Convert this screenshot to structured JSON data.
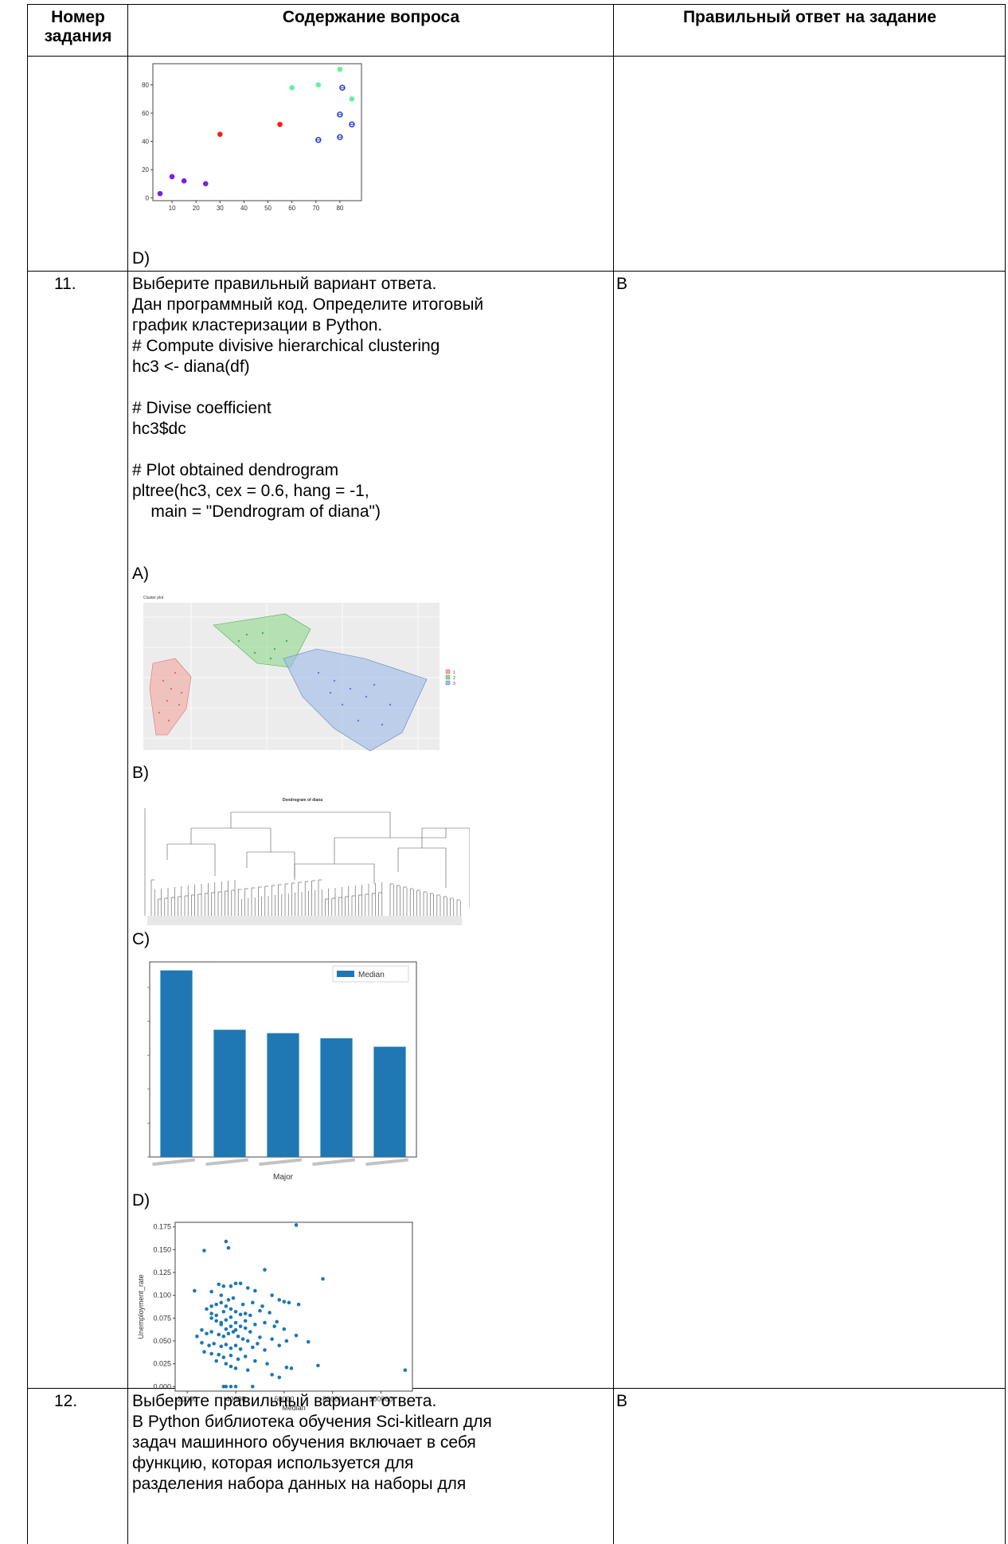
{
  "header": {
    "col1": [
      "Номер",
      "задания"
    ],
    "col2": "Содержание вопроса",
    "col3": "Правильный ответ на задание"
  },
  "row0": {
    "option_label": "D)"
  },
  "q11": {
    "number": "11.",
    "lines": [
      "Выберите правильный вариант ответа.",
      "Дан программный код. Определите итоговый",
      "график кластеризации в Python.",
      "# Compute divisive hierarchical clustering",
      "hc3 <- diana(df)",
      "",
      "# Divise coefficient",
      "hc3$dc",
      "",
      "# Plot obtained dendrogram",
      "pltree(hc3, cex = 0.6, hang = -1,",
      "    main = \"Dendrogram of diana\")"
    ],
    "answer": "B",
    "options": [
      "A)",
      "B)",
      "C)",
      "D)"
    ]
  },
  "q12": {
    "number": "12.",
    "lines": [
      "Выберите правильный вариант ответа.",
      "В Python библиотека обучения Sci-kitlearn для",
      "задач машинного обучения включает в себя",
      "функцию, которая используется для",
      "разделения набора данных на наборы для"
    ],
    "answer": "B"
  },
  "chart_data": [
    {
      "type": "scatter",
      "xlim": [
        2,
        89
      ],
      "ylim": [
        -2,
        95
      ],
      "x_ticks": [
        "10",
        "20",
        "30",
        "40",
        "50",
        "60",
        "70",
        "80"
      ],
      "y_ticks": [
        "0",
        "20",
        "40",
        "60",
        "80"
      ],
      "series": [
        {
          "color": "#7b1fe0",
          "marker": "dot",
          "x": [
            5,
            10,
            15,
            24
          ],
          "y": [
            3,
            15,
            12,
            10
          ]
        },
        {
          "color": "#ff1a1a",
          "marker": "dot",
          "x": [
            30,
            55
          ],
          "y": [
            45,
            52
          ]
        },
        {
          "color": "#66f0a0",
          "marker": "dot",
          "x": [
            60,
            71,
            80,
            85
          ],
          "y": [
            78,
            80,
            91,
            70
          ]
        },
        {
          "color": "#2233dd",
          "marker": "ring",
          "x": [
            71,
            80,
            80,
            81,
            85
          ],
          "y": [
            41,
            43,
            59,
            78,
            52
          ]
        }
      ]
    },
    {
      "type": "scatter",
      "title": "Cluster plot",
      "series": [
        {
          "name": "1",
          "color": "#f4a6a0"
        },
        {
          "name": "2",
          "color": "#8fd98f"
        },
        {
          "name": "3",
          "color": "#9dbbe8"
        }
      ]
    },
    {
      "type": "line",
      "title": "Dendrogram of diana"
    },
    {
      "type": "bar",
      "xlabel": "Major",
      "ylim": [
        0,
        115000
      ],
      "legend": "top-right",
      "series": [
        {
          "name": "Median",
          "color": "#1f77b4",
          "values": [
            110000,
            75000,
            73000,
            70000,
            65000
          ]
        }
      ]
    },
    {
      "type": "scatter",
      "xlabel": "Median",
      "ylabel": "Unemployment_rate",
      "xlim": [
        15000,
        113000
      ],
      "ylim": [
        -0.005,
        0.18
      ],
      "x_ticks": [
        "20000",
        "40000",
        "60000",
        "80000",
        "100000"
      ],
      "y_ticks": [
        "0.000",
        "0.025",
        "0.050",
        "0.075",
        "0.100",
        "0.125",
        "0.150",
        "0.175"
      ],
      "color": "#1f77b4",
      "points": [
        [
          65000,
          0.177
        ],
        [
          110000,
          0.018
        ],
        [
          76000,
          0.118
        ],
        [
          27000,
          0.149
        ],
        [
          36000,
          0.159
        ],
        [
          37000,
          0.152
        ],
        [
          52000,
          0.128
        ],
        [
          23000,
          0.105
        ],
        [
          74000,
          0.023
        ],
        [
          61000,
          0.021
        ],
        [
          63000,
          0.02
        ],
        [
          70000,
          0.049
        ],
        [
          58000,
          0.01
        ],
        [
          55000,
          0.013
        ],
        [
          36000,
          0.0
        ],
        [
          38000,
          0.0
        ],
        [
          40000,
          0.0
        ],
        [
          35000,
          0.0
        ],
        [
          47000,
          0.0
        ],
        [
          30000,
          0.104
        ],
        [
          33000,
          0.112
        ],
        [
          35000,
          0.11
        ],
        [
          38000,
          0.11
        ],
        [
          40000,
          0.113
        ],
        [
          42000,
          0.113
        ],
        [
          45000,
          0.108
        ],
        [
          48000,
          0.105
        ],
        [
          55000,
          0.1
        ],
        [
          58000,
          0.095
        ],
        [
          60000,
          0.093
        ],
        [
          62000,
          0.092
        ],
        [
          66000,
          0.09
        ],
        [
          28000,
          0.085
        ],
        [
          30000,
          0.088
        ],
        [
          32000,
          0.09
        ],
        [
          34000,
          0.092
        ],
        [
          36000,
          0.088
        ],
        [
          38000,
          0.085
        ],
        [
          40000,
          0.082
        ],
        [
          42000,
          0.079
        ],
        [
          44000,
          0.08
        ],
        [
          46000,
          0.078
        ],
        [
          50000,
          0.083
        ],
        [
          54000,
          0.081
        ],
        [
          30000,
          0.075
        ],
        [
          32000,
          0.072
        ],
        [
          34000,
          0.07
        ],
        [
          36000,
          0.073
        ],
        [
          38000,
          0.076
        ],
        [
          40000,
          0.07
        ],
        [
          42000,
          0.066
        ],
        [
          44000,
          0.064
        ],
        [
          48000,
          0.068
        ],
        [
          52000,
          0.07
        ],
        [
          56000,
          0.066
        ],
        [
          60000,
          0.063
        ],
        [
          26000,
          0.062
        ],
        [
          28000,
          0.058
        ],
        [
          30000,
          0.06
        ],
        [
          33000,
          0.057
        ],
        [
          35000,
          0.055
        ],
        [
          37000,
          0.058
        ],
        [
          39000,
          0.06
        ],
        [
          41000,
          0.055
        ],
        [
          43000,
          0.052
        ],
        [
          45000,
          0.05
        ],
        [
          50000,
          0.054
        ],
        [
          55000,
          0.052
        ],
        [
          65000,
          0.056
        ],
        [
          24000,
          0.055
        ],
        [
          26000,
          0.048
        ],
        [
          29000,
          0.045
        ],
        [
          31000,
          0.047
        ],
        [
          34000,
          0.044
        ],
        [
          36000,
          0.046
        ],
        [
          38000,
          0.042
        ],
        [
          40000,
          0.045
        ],
        [
          42000,
          0.041
        ],
        [
          47000,
          0.043
        ],
        [
          52000,
          0.04
        ],
        [
          58000,
          0.045
        ],
        [
          27000,
          0.038
        ],
        [
          30000,
          0.036
        ],
        [
          33000,
          0.035
        ],
        [
          35000,
          0.032
        ],
        [
          38000,
          0.034
        ],
        [
          41000,
          0.03
        ],
        [
          44000,
          0.033
        ],
        [
          48000,
          0.028
        ],
        [
          53000,
          0.025
        ],
        [
          36000,
          0.025
        ],
        [
          38000,
          0.022
        ],
        [
          40000,
          0.02
        ],
        [
          45000,
          0.018
        ],
        [
          32000,
          0.028
        ],
        [
          34000,
          0.068
        ],
        [
          36000,
          0.063
        ],
        [
          38000,
          0.066
        ],
        [
          40000,
          0.062
        ],
        [
          30000,
          0.08
        ],
        [
          32000,
          0.078
        ],
        [
          35000,
          0.082
        ],
        [
          37000,
          0.095
        ],
        [
          39000,
          0.097
        ],
        [
          34000,
          0.1
        ],
        [
          43000,
          0.09
        ],
        [
          47000,
          0.092
        ],
        [
          51000,
          0.088
        ],
        [
          44000,
          0.072
        ],
        [
          46000,
          0.06
        ],
        [
          49000,
          0.047
        ],
        [
          57000,
          0.071
        ],
        [
          61000,
          0.05
        ]
      ]
    }
  ]
}
